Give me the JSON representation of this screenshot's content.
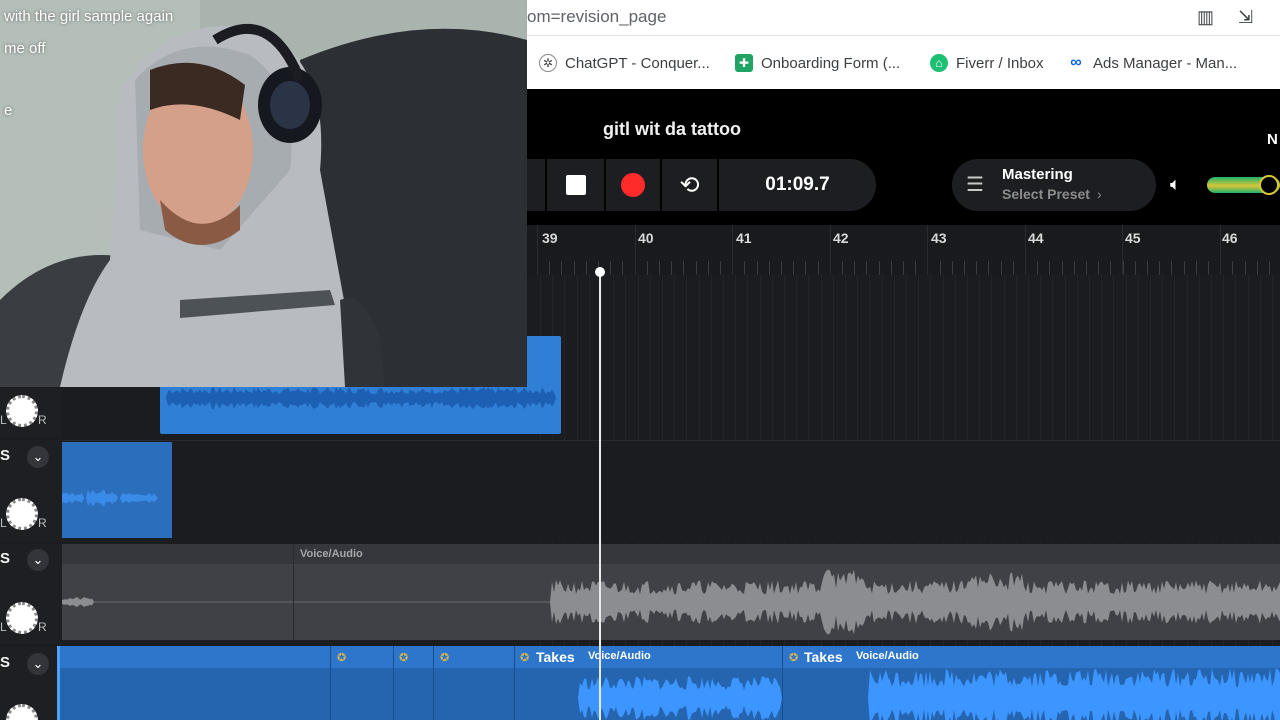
{
  "browser": {
    "url": "om=revision_page",
    "bookmarks": [
      {
        "label": "ChatGPT - Conquer...",
        "icon": "chatgpt-icon",
        "color": "#444444"
      },
      {
        "label": "Onboarding Form (...",
        "icon": "sheets-icon",
        "color": "#1fa463"
      },
      {
        "label": "Fiverr / Inbox",
        "icon": "fiverr-icon",
        "color": "#1dbf73"
      },
      {
        "label": "Ads Manager - Man...",
        "icon": "meta-icon",
        "color": "#0866ff"
      }
    ]
  },
  "daw": {
    "project_title": "gitl wit da tattoo",
    "time": "01:09.7",
    "mastering_title": "Mastering",
    "mastering_sub": "Select Preset",
    "header_letter": "N",
    "volume_level": 0.85,
    "ruler": [
      "39",
      "40",
      "41",
      "42",
      "43",
      "44",
      "45",
      "46"
    ],
    "tracks": [
      {
        "solo": "S",
        "knob_l": "L",
        "knob_r": "R"
      },
      {
        "solo": "S",
        "knob_l": "L",
        "knob_r": "R"
      },
      {
        "solo": "S",
        "knob_l": "L",
        "knob_r": "R"
      }
    ],
    "clip_labels": {
      "voice_audio": "Voice/Audio",
      "takes": "Takes"
    },
    "colors": {
      "blue_clip": "#2f7fd6",
      "grey_clip": "#4a4b50",
      "record": "#ff2b2b"
    }
  },
  "overlay": {
    "chat_lines": [
      "with the girl sample again",
      "me off",
      "e"
    ]
  }
}
